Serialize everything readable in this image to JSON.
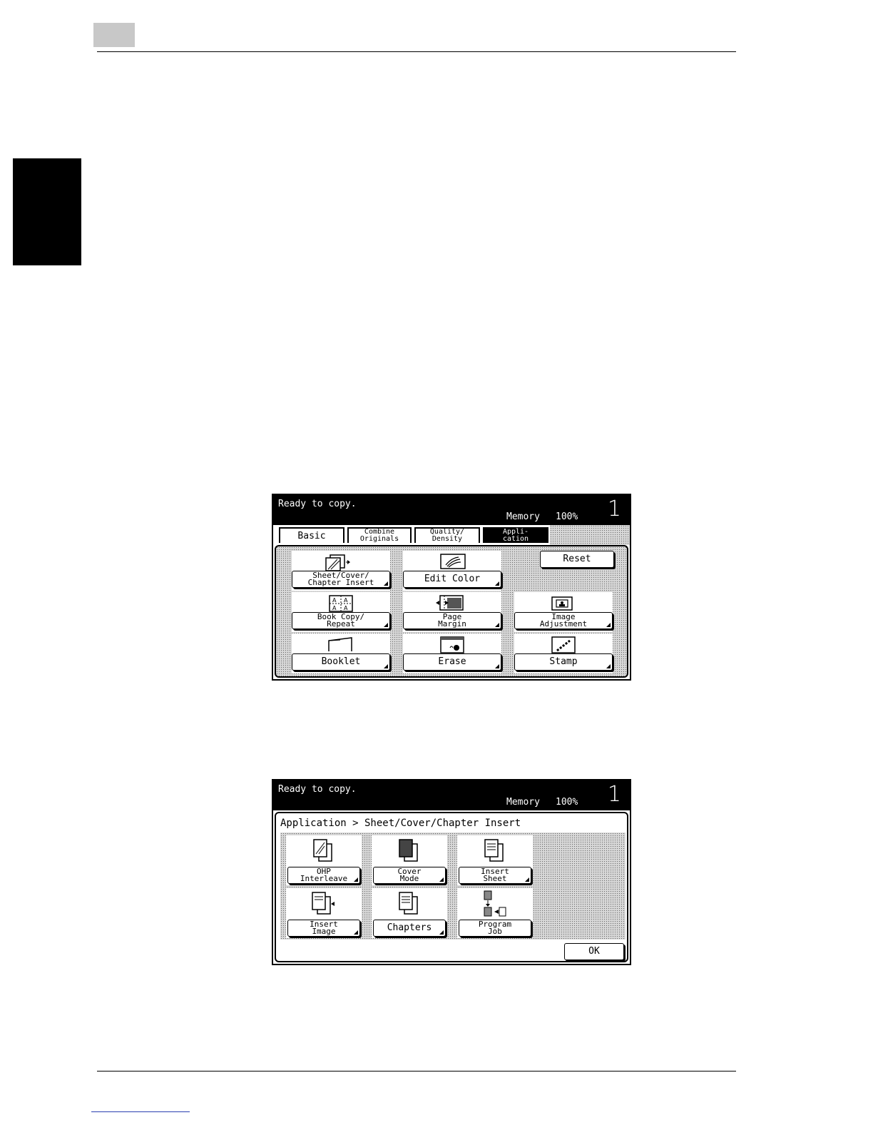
{
  "screen1": {
    "status": "Ready to copy.",
    "memory_label": "Memory",
    "memory_value": "100%",
    "copy_count": "1",
    "tabs": [
      {
        "label": "Basic"
      },
      {
        "label": "Combine\nOriginals"
      },
      {
        "label": "Quality/\nDensity"
      },
      {
        "label": "Appli-\ncation"
      }
    ],
    "reset_label": "Reset",
    "functions": [
      {
        "label": "Sheet/Cover/\nChapter Insert",
        "icon": "sheet-insert-icon"
      },
      {
        "label": "Edit Color",
        "icon": "edit-color-icon"
      },
      {
        "label": "Book Copy/\nRepeat",
        "icon": "book-copy-icon"
      },
      {
        "label": "Page\nMargin",
        "icon": "page-margin-icon"
      },
      {
        "label": "Image\nAdjustment",
        "icon": "image-adjustment-icon"
      },
      {
        "label": "Booklet",
        "icon": "booklet-icon"
      },
      {
        "label": "Erase",
        "icon": "erase-icon"
      },
      {
        "label": "Stamp",
        "icon": "stamp-icon"
      }
    ]
  },
  "screen2": {
    "status": "Ready to copy.",
    "memory_label": "Memory",
    "memory_value": "100%",
    "copy_count": "1",
    "breadcrumb": "Application > Sheet/Cover/Chapter Insert",
    "functions": [
      {
        "label": "OHP\nInterleave",
        "icon": "ohp-interleave-icon"
      },
      {
        "label": "Cover\nMode",
        "icon": "cover-mode-icon"
      },
      {
        "label": "Insert\nSheet",
        "icon": "insert-sheet-icon"
      },
      {
        "label": "Insert\nImage",
        "icon": "insert-image-icon"
      },
      {
        "label": "Chapters",
        "icon": "chapters-icon"
      },
      {
        "label": "Program\nJob",
        "icon": "program-job-icon"
      }
    ],
    "ok_label": "OK"
  }
}
